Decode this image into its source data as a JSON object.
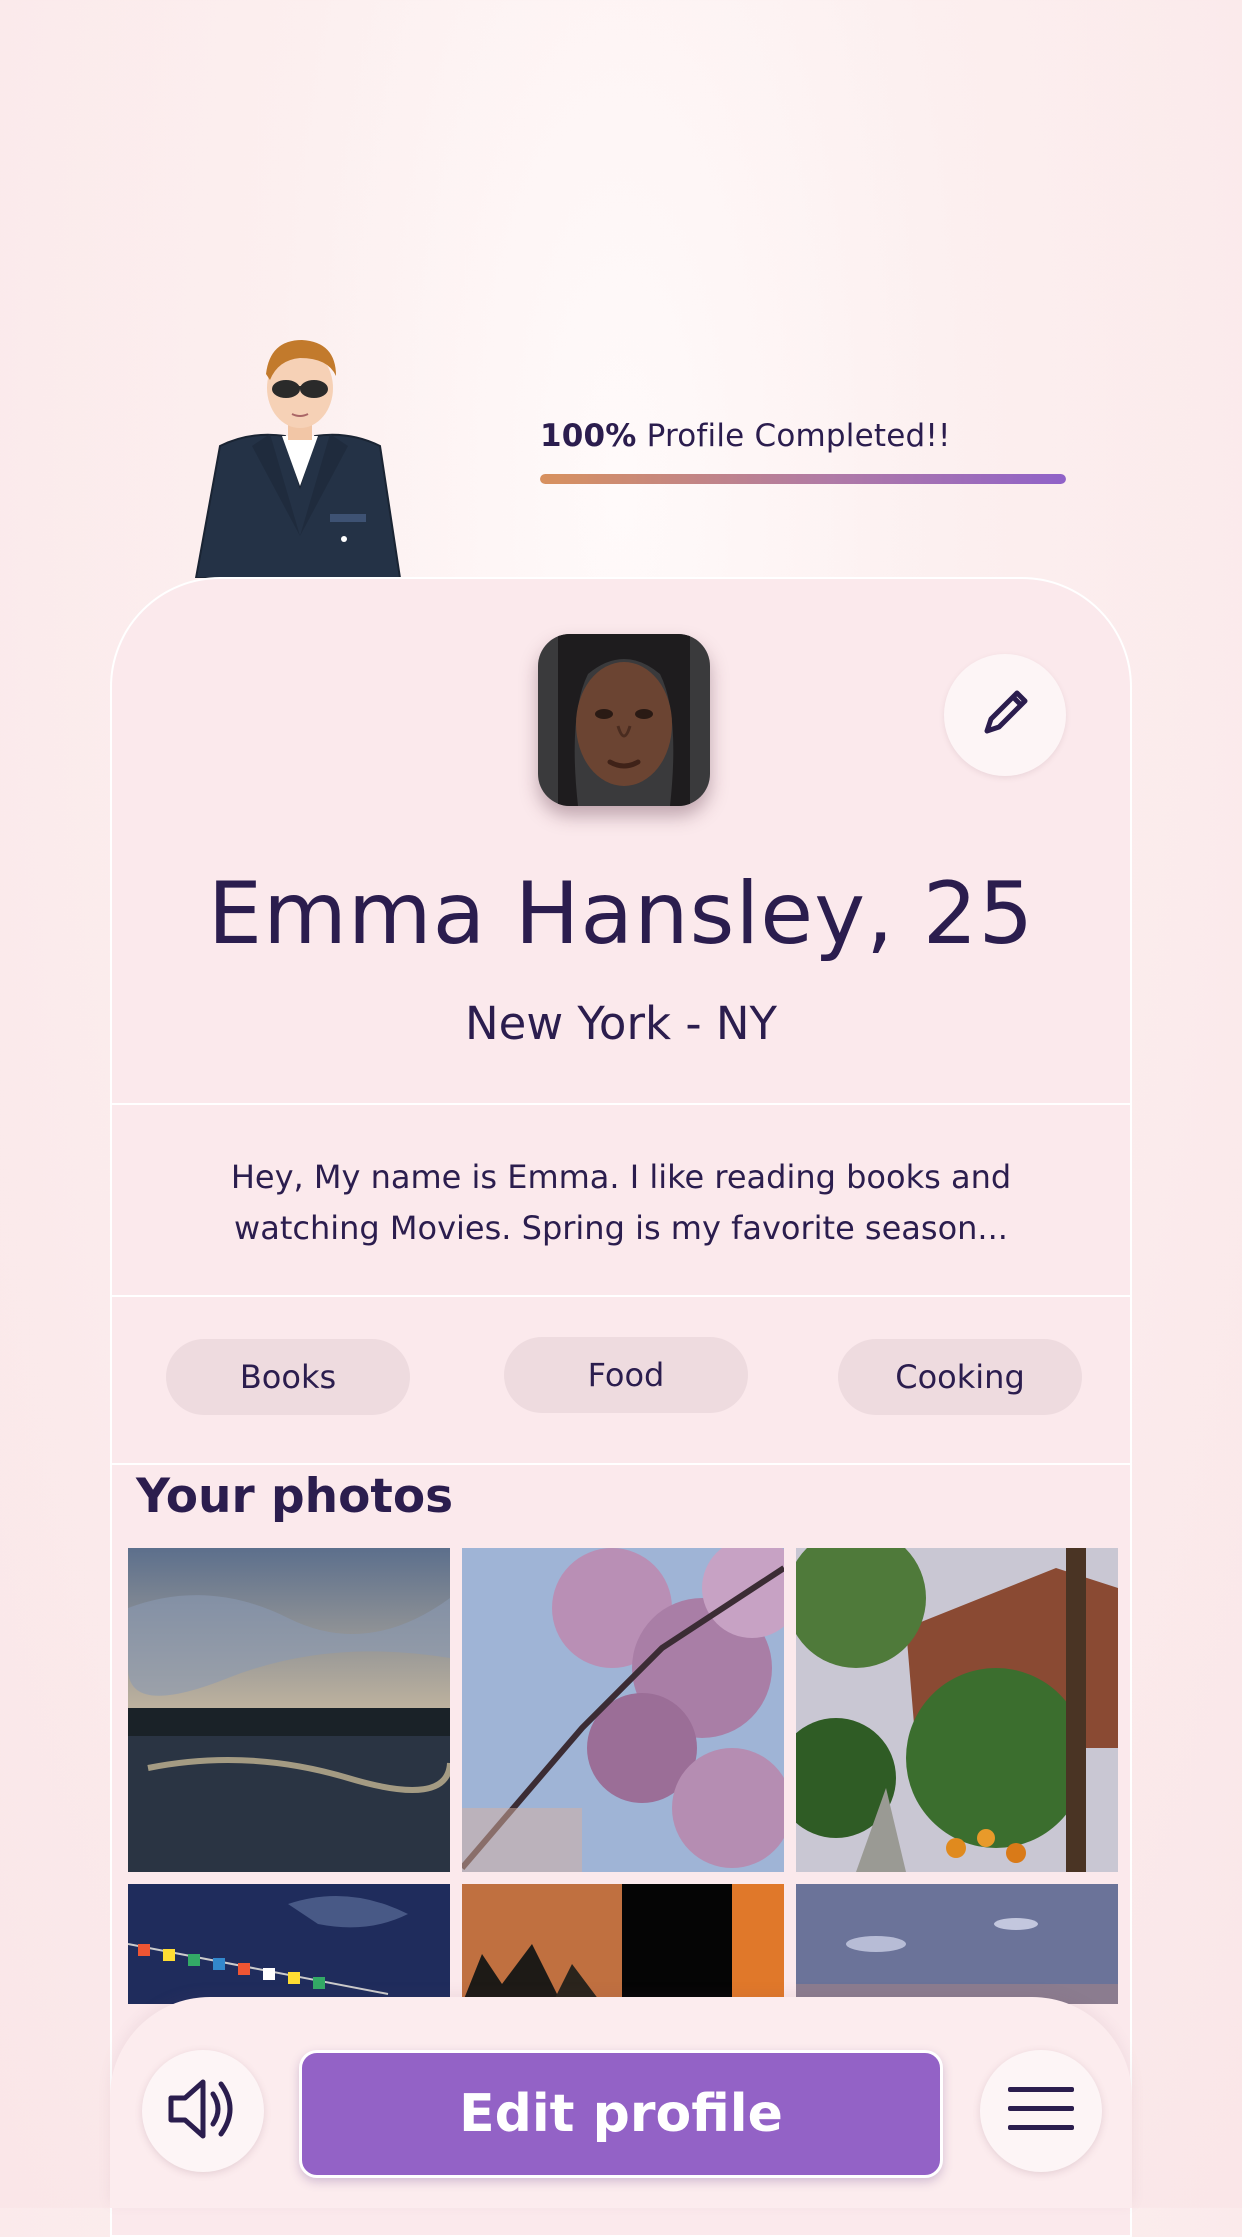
{
  "progress": {
    "percent_label": "100%",
    "text": "Profile Completed!!",
    "value": 1.0
  },
  "profile": {
    "name": "Emma Hansley, 25",
    "location": "New York - NY",
    "bio_line1": "Hey, My name is Emma. I like reading books and",
    "bio_line2": "watching Movies. Spring is my favorite season...",
    "interests": [
      "Books",
      "Food",
      "Cooking"
    ]
  },
  "photos": {
    "title": "Your photos"
  },
  "bottom": {
    "edit_label": "Edit profile"
  },
  "icons": {
    "edit": "pencil-icon",
    "sound": "speaker-icon",
    "menu": "hamburger-menu-icon"
  },
  "colors": {
    "accent": "#9362c6",
    "text": "#2b1d4e",
    "card": "#fbe9ec",
    "tag": "#eedbdf"
  }
}
